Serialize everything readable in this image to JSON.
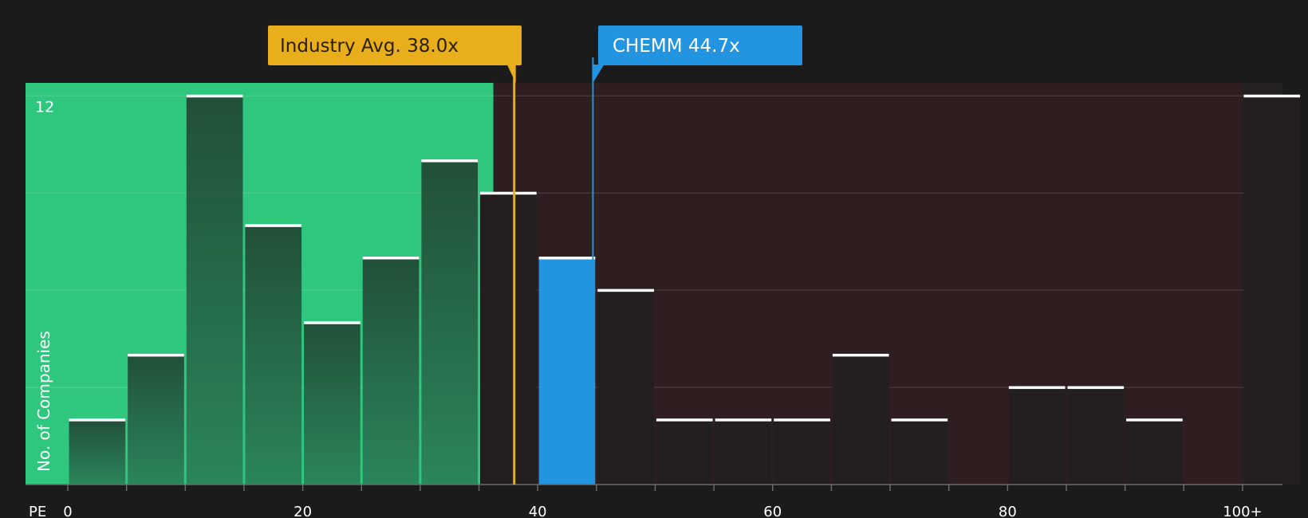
{
  "chart_data": {
    "type": "bar",
    "title": "",
    "xlabel": "PE",
    "ylabel": "No. of Companies",
    "x_tick_labels": [
      "0",
      "20",
      "40",
      "60",
      "80",
      "100+"
    ],
    "x_tick_values": [
      0,
      20,
      40,
      60,
      80,
      100
    ],
    "y_tick_labels": [
      "12"
    ],
    "y_tick_values": [
      12
    ],
    "ylim": [
      0,
      12.4
    ],
    "xlim": [
      -3.6,
      103.4
    ],
    "grid": true,
    "bins": [
      {
        "from": 0,
        "to": 5,
        "count": 2
      },
      {
        "from": 5,
        "to": 10,
        "count": 4
      },
      {
        "from": 10,
        "to": 15,
        "count": 12
      },
      {
        "from": 15,
        "to": 20,
        "count": 8
      },
      {
        "from": 20,
        "to": 25,
        "count": 5
      },
      {
        "from": 25,
        "to": 30,
        "count": 7
      },
      {
        "from": 30,
        "to": 35,
        "count": 10
      },
      {
        "from": 35,
        "to": 40,
        "count": 9
      },
      {
        "from": 40,
        "to": 45,
        "count": 7,
        "highlight": true
      },
      {
        "from": 45,
        "to": 50,
        "count": 6
      },
      {
        "from": 50,
        "to": 55,
        "count": 2
      },
      {
        "from": 55,
        "to": 60,
        "count": 2
      },
      {
        "from": 60,
        "to": 65,
        "count": 2
      },
      {
        "from": 65,
        "to": 70,
        "count": 4
      },
      {
        "from": 70,
        "to": 75,
        "count": 2
      },
      {
        "from": 75,
        "to": 80,
        "count": 0
      },
      {
        "from": 80,
        "to": 85,
        "count": 3
      },
      {
        "from": 85,
        "to": 90,
        "count": 3
      },
      {
        "from": 90,
        "to": 95,
        "count": 2
      },
      {
        "from": 95,
        "to": 100,
        "count": 0
      },
      {
        "from": 100,
        "to": 105,
        "count": 12
      }
    ],
    "annotations": [
      {
        "label": "Industry Avg. 38.0x",
        "value": 38.0,
        "color": "#e8ae1c"
      },
      {
        "label": "CHEMM 44.7x",
        "value": 44.7,
        "color": "#2394e0"
      }
    ],
    "colors": {
      "background": "#1b1b1c",
      "favorable_region": "#2fc67e",
      "unfavorable_region": "#2e1e1f",
      "highlight_bar": "#2394e0",
      "bar_cap": "#ffffff",
      "text": "#ffffff"
    }
  }
}
